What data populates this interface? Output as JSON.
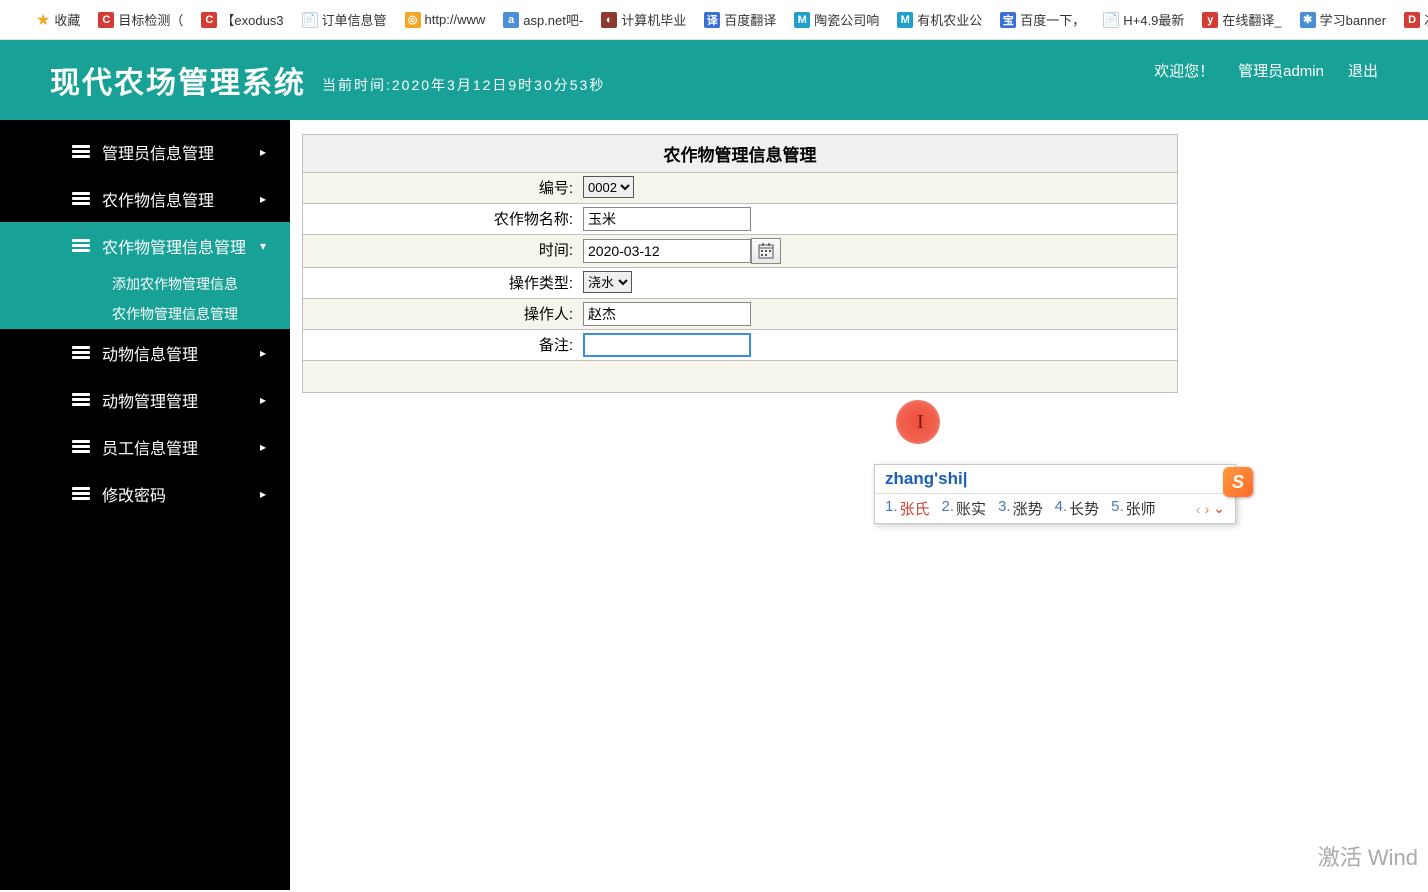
{
  "bookmarks": {
    "fav_label": "收藏",
    "items": [
      {
        "label": "目标检测（",
        "icon_bg": "#d43b34",
        "icon_txt": "C"
      },
      {
        "label": "【exodus3",
        "icon_bg": "#d43b34",
        "icon_txt": "C"
      },
      {
        "label": "订单信息管",
        "icon_bg": "#ffffff",
        "icon_txt": "📄"
      },
      {
        "label": "http://www",
        "icon_bg": "#f5a623",
        "icon_txt": "◎"
      },
      {
        "label": "asp.net吧-",
        "icon_bg": "#4a8fd6",
        "icon_txt": "a"
      },
      {
        "label": "计算机毕业",
        "icon_bg": "#8b3a2e",
        "icon_txt": "◐"
      },
      {
        "label": "百度翻译",
        "icon_bg": "#3a6fd6",
        "icon_txt": "译"
      },
      {
        "label": "陶瓷公司响",
        "icon_bg": "#1fa0c8",
        "icon_txt": "M"
      },
      {
        "label": "有机农业公",
        "icon_bg": "#1fa0c8",
        "icon_txt": "M"
      },
      {
        "label": "百度一下，",
        "icon_bg": "#3a6fd6",
        "icon_txt": "宝"
      },
      {
        "label": "H+4.9最新",
        "icon_bg": "#ffffff",
        "icon_txt": "📄"
      },
      {
        "label": "在线翻译_",
        "icon_bg": "#d43b34",
        "icon_txt": "y"
      },
      {
        "label": "学习banner",
        "icon_bg": "#4a8fd6",
        "icon_txt": "✱"
      },
      {
        "label": "次元仓",
        "icon_bg": "#d43b34",
        "icon_txt": "D"
      }
    ]
  },
  "header": {
    "title": "现代农场管理系统",
    "time_label": "当前时间:2020年3月12日9时30分53秒",
    "welcome": "欢迎您！",
    "admin": "管理员admin",
    "logout": "退出"
  },
  "sidebar": {
    "items": [
      {
        "label": "管理员信息管理",
        "active": false,
        "arrow": "▸"
      },
      {
        "label": "农作物信息管理",
        "active": false,
        "arrow": "▸"
      },
      {
        "label": "农作物管理信息管理",
        "active": true,
        "arrow": "▾",
        "sub": [
          {
            "label": "添加农作物管理信息"
          },
          {
            "label": "农作物管理信息管理"
          }
        ]
      },
      {
        "label": "动物信息管理",
        "active": false,
        "arrow": "▸"
      },
      {
        "label": "动物管理管理",
        "active": false,
        "arrow": "▸"
      },
      {
        "label": "员工信息管理",
        "active": false,
        "arrow": "▸"
      },
      {
        "label": "修改密码",
        "active": false,
        "arrow": "▸"
      }
    ]
  },
  "form": {
    "panel_title": "农作物管理信息管理",
    "rows": {
      "id_label": "编号:",
      "id_value": "0002",
      "name_label": "农作物名称:",
      "name_value": "玉米",
      "time_label": "时间:",
      "time_value": "2020-03-12",
      "op_type_label": "操作类型:",
      "op_type_value": "浇水",
      "operator_label": "操作人:",
      "operator_value": "赵杰",
      "remark_label": "备注:",
      "remark_value": ""
    }
  },
  "ime": {
    "input": "zhang'shi",
    "candidates": [
      {
        "n": "1.",
        "t": "张氏"
      },
      {
        "n": "2.",
        "t": "账实"
      },
      {
        "n": "3.",
        "t": "涨势"
      },
      {
        "n": "4.",
        "t": "长势"
      },
      {
        "n": "5.",
        "t": "张师"
      }
    ],
    "logo": "S"
  },
  "watermark": "激活 Wind"
}
